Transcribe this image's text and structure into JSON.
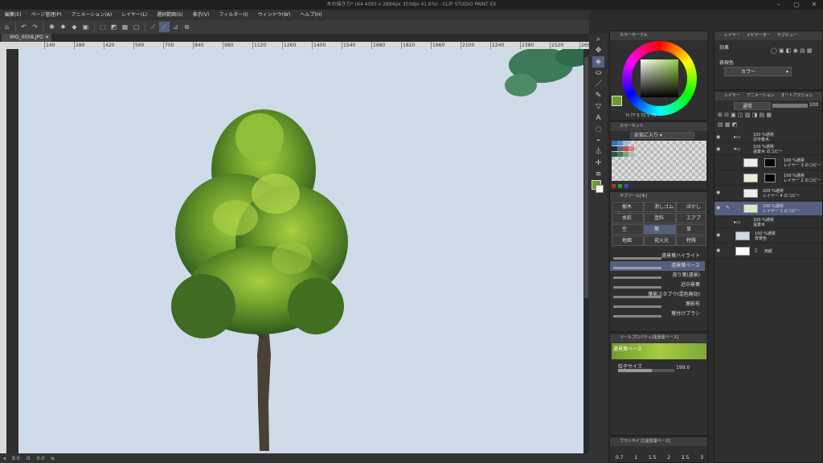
{
  "window": {
    "title": "木の描き方* (A4 4093 x 2894px 350dpi 41.6%) - CLIP STUDIO PAINT EX"
  },
  "menu": [
    "編集(E)",
    "ページ管理(P)",
    "アニメーション(A)",
    "レイヤー(L)",
    "選択範囲(S)",
    "表示(V)",
    "フィルター(I)",
    "ウィンドウ(W)",
    "ヘルプ(H)"
  ],
  "document": {
    "tab_label": "IMG_0058.JPG"
  },
  "ruler": {
    "ticks": [
      "140",
      "280",
      "420",
      "560",
      "700",
      "840",
      "980",
      "1120",
      "1260",
      "1400",
      "1540",
      "1680",
      "1820",
      "1960",
      "2100",
      "2240",
      "2380",
      "2520",
      "2660"
    ]
  },
  "status": {
    "zoom": "8.0",
    "angle": "0.0"
  },
  "colors": {
    "accent": "#6f9a2e",
    "canvas_bg": "#cfdbe8",
    "panel_bg": "#2f2f2f",
    "selected_row": "#556080"
  },
  "color_wheel": {
    "header": "カラーサークル",
    "h_value": "77",
    "s_value": "72",
    "v_value": "75"
  },
  "swatch": {
    "header": "カラーセット",
    "set_name": "お気に入り"
  },
  "subtool": {
    "header": "サブツール[木]",
    "groups": [
      "樹木",
      "消しゴム",
      "ぼかし",
      "水彩",
      "塗料",
      "エアブラシ",
      "空",
      "葉",
      "草",
      "地面",
      "花火光",
      "特殊"
    ],
    "brushes": [
      "遠景葉ハイライト",
      "遠景葉ベース",
      "茂り葉(遠景)",
      "近中景葉",
      "葉影スタブウ(混色無効)",
      "葉影布",
      "葉付けブラシ"
    ]
  },
  "tool_property": {
    "header": "ツールプロパティ[遠景葉ベース]",
    "brush_name": "遠景葉ベース",
    "particle_label": "粒子サイズ",
    "particle_value": "199.0"
  },
  "brush_size": {
    "header": "ブラシサイズ[遠景葉ベース]",
    "values": [
      "0.7",
      "1",
      "1.5",
      "2",
      "2.5",
      "3"
    ]
  },
  "effect": {
    "tabs": [
      "レイヤー",
      "ナビゲーター",
      "サブビュー"
    ],
    "label": "効果",
    "expression_label": "表現色",
    "expression_value": "カラー"
  },
  "layers": {
    "tabs": [
      "レイヤー",
      "アニメーション",
      "オートアクション"
    ],
    "blend_mode": "通常",
    "opacity": "100",
    "items": [
      {
        "percent": "100 %通常",
        "name": "近中景木"
      },
      {
        "percent": "100 %通常",
        "name": "遠景木 のコピー"
      },
      {
        "percent": "100 %通常",
        "name": "レイヤー 3 のコピー"
      },
      {
        "percent": "100 %通常",
        "name": "レイヤー 2 のコピー"
      },
      {
        "percent": "100 %通常",
        "name": "レイヤー 4 のコピー"
      },
      {
        "percent": "100 %通常",
        "name": "レイヤー 1 のコピー"
      },
      {
        "percent": "100 %通常",
        "name": "遠景木"
      },
      {
        "percent": "100 %通常",
        "name": "背景色"
      },
      {
        "percent": "",
        "name": "用紙"
      }
    ]
  }
}
